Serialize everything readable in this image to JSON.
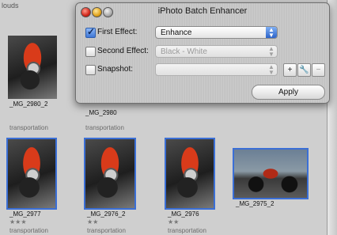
{
  "library": {
    "top_label": "louds",
    "photos": [
      {
        "name": "_MG_2980_2",
        "tag": "transportation",
        "stars": ""
      },
      {
        "name": "_MG_2980",
        "tag": "transportation",
        "stars": ""
      },
      {
        "name": "_MG_2977",
        "tag": "transportation",
        "stars": "★★★"
      },
      {
        "name": "_MG_2976_2",
        "tag": "transportation",
        "stars": "★★"
      },
      {
        "name": "_MG_2976",
        "tag": "transportation",
        "stars": "★★"
      },
      {
        "name": "_MG_2975_2",
        "tag": "",
        "stars": ""
      }
    ]
  },
  "panel": {
    "title": "iPhoto Batch Enhancer",
    "first_effect": {
      "label": "First Effect:",
      "checked": true,
      "value": "Enhance"
    },
    "second_effect": {
      "label": "Second Effect:",
      "checked": false,
      "value": "Black - White"
    },
    "snapshot": {
      "label": "Snapshot:",
      "checked": false,
      "value": ""
    },
    "add_button": "+",
    "tool_button": "🔧",
    "remove_button": "−",
    "apply_label": "Apply"
  },
  "colors": {
    "selection": "#3b6fd6",
    "popup_arrow": "#2c63c8"
  }
}
